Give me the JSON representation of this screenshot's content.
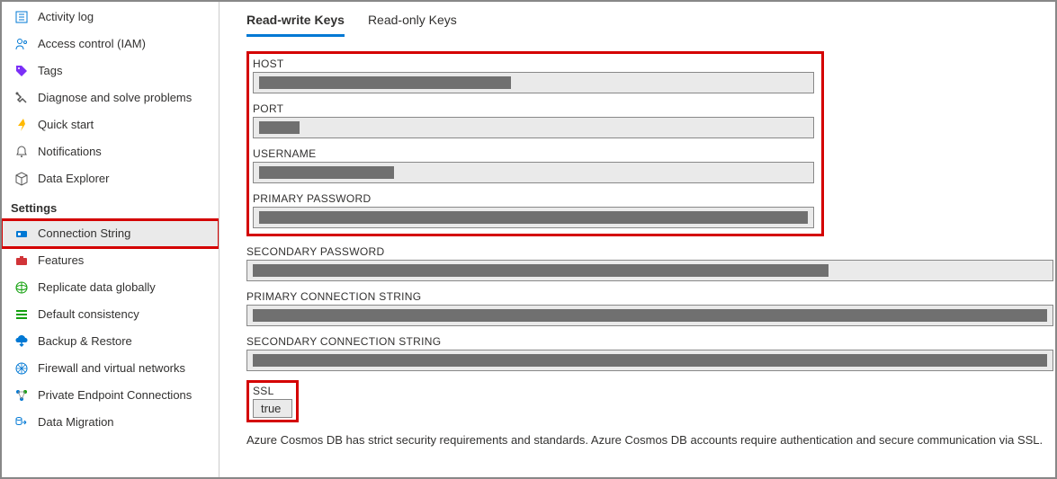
{
  "sidebar": {
    "items_top": [
      {
        "label": "Activity log",
        "icon": "activity-log-icon",
        "color": "#0078d4"
      },
      {
        "label": "Access control (IAM)",
        "icon": "access-control-icon",
        "color": "#0078d4"
      },
      {
        "label": "Tags",
        "icon": "tag-icon",
        "color": "#7b2ff7"
      },
      {
        "label": "Diagnose and solve problems",
        "icon": "diagnose-icon",
        "color": "#555"
      },
      {
        "label": "Quick start",
        "icon": "quickstart-icon",
        "color": "#ffb900"
      },
      {
        "label": "Notifications",
        "icon": "notifications-icon",
        "color": "#555"
      },
      {
        "label": "Data Explorer",
        "icon": "data-explorer-icon",
        "color": "#555"
      }
    ],
    "section_title": "Settings",
    "items_settings": [
      {
        "label": "Connection String",
        "icon": "connection-string-icon",
        "active": true,
        "highlight": true,
        "color": "#0078d4"
      },
      {
        "label": "Features",
        "icon": "features-icon",
        "color": "#d13438"
      },
      {
        "label": "Replicate data globally",
        "icon": "replicate-icon",
        "color": "#13a10e"
      },
      {
        "label": "Default consistency",
        "icon": "consistency-icon",
        "color": "#13a10e"
      },
      {
        "label": "Backup & Restore",
        "icon": "backup-icon",
        "color": "#0078d4"
      },
      {
        "label": "Firewall and virtual networks",
        "icon": "firewall-icon",
        "color": "#0078d4"
      },
      {
        "label": "Private Endpoint Connections",
        "icon": "private-endpoint-icon",
        "color": "#0078d4"
      },
      {
        "label": "Data Migration",
        "icon": "data-migration-icon",
        "color": "#0078d4"
      }
    ]
  },
  "tabs": [
    {
      "label": "Read-write Keys",
      "active": true
    },
    {
      "label": "Read-only Keys",
      "active": false
    }
  ],
  "fields": {
    "host_label": "HOST",
    "port_label": "PORT",
    "username_label": "USERNAME",
    "primary_password_label": "PRIMARY PASSWORD",
    "secondary_password_label": "SECONDARY PASSWORD",
    "primary_connstr_label": "PRIMARY CONNECTION STRING",
    "secondary_connstr_label": "SECONDARY CONNECTION STRING",
    "ssl_label": "SSL",
    "ssl_value": "true"
  },
  "footer_text": "Azure Cosmos DB has strict security requirements and standards. Azure Cosmos DB accounts require authentication and secure communication via SSL."
}
